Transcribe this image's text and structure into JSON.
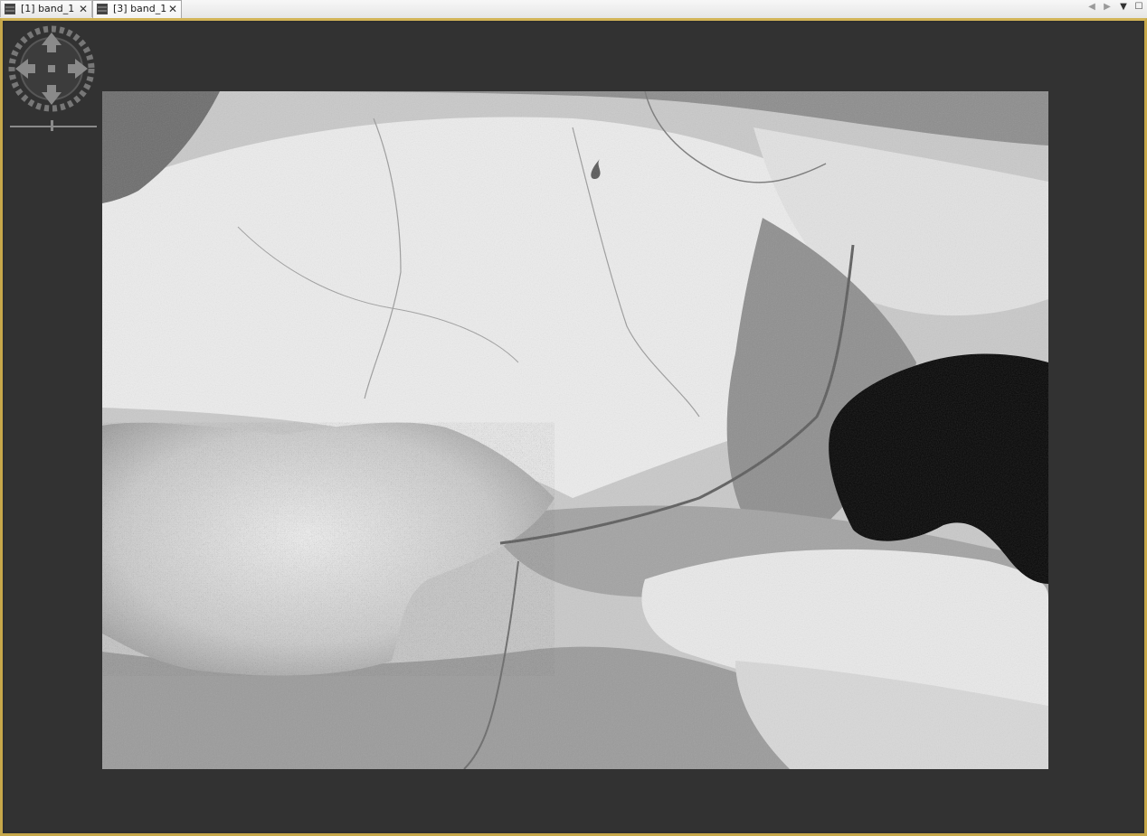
{
  "tabs": [
    {
      "label": "[1] band_1",
      "close": "✕",
      "active": false
    },
    {
      "label": "[3] band_1",
      "close": "✕",
      "active": true
    }
  ],
  "window_controls": {
    "left": "◀",
    "right": "▶",
    "menu": "▼",
    "maximize": "☐"
  },
  "colors": {
    "frame_border": "#c7a84a",
    "canvas_background": "#323232",
    "navigation_control": "#8a8a8a"
  },
  "image": {
    "band": "band_1",
    "style": "grayscale satellite raster"
  }
}
